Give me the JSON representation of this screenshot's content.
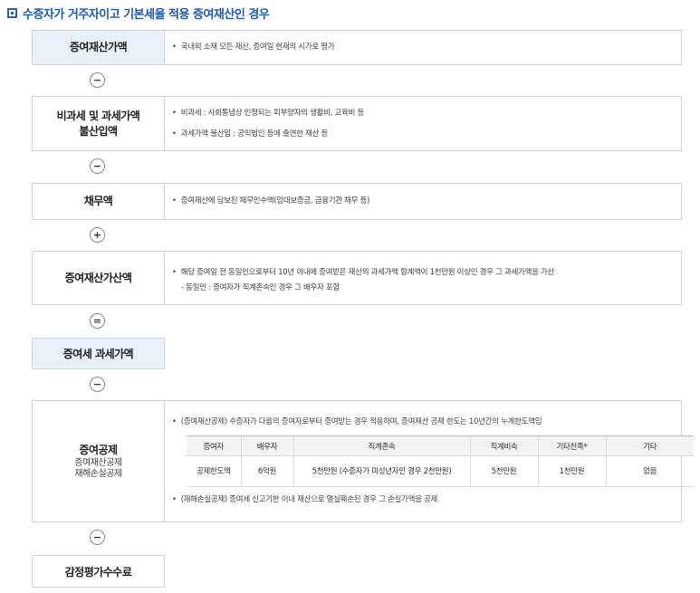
{
  "title": "수증자가 거주자이고 기본세율 적용 증여재산인 경우",
  "operators": {
    "minus": "−",
    "plus": "+",
    "equals": "="
  },
  "rows": {
    "r1": {
      "label": "증여재산가액",
      "bullets": [
        "국내외 소재 모든 재산, 증여일 현재의 시가로 평가"
      ]
    },
    "r2": {
      "label_line1": "비과세 및 과세가액",
      "label_line2": "불산입액",
      "bullets": [
        "비과세 : 사회통념상 인정되는 피부양자의 생활비, 교육비 등",
        "과세가액 불산입 : 공익법인 등에 출연한 재산 등"
      ]
    },
    "r3": {
      "label": "채무액",
      "bullets": [
        "증여재산에 담보된 채무인수액(임대보증금, 금융기관 채무 등)"
      ]
    },
    "r4": {
      "label": "증여재산가산액",
      "bullets": [
        "해당 증여일 전 동일인으로부터 10년 이내에 증여받은 재산의 과세가액 합계액이 1천만원 이상인 경우 그 과세가액을 가산"
      ],
      "dash": "- 동일인 : 증여자가 직계존속인 경우 그 배우자 포함"
    },
    "r5": {
      "label": "증여세 과세가액"
    },
    "r6": {
      "label": "증여공제",
      "sub1": "증여재산공제",
      "sub2": "재해손실공제",
      "bullet1": "(증여재산공제) 수증자가 다음의 증여자로부터 증여받는 경우 적용하며, 증여재산 공제 한도는 10년간의 누계한도액임",
      "bullet2": "(재해손실공제) 증여세 신고기한 이내 재산으로 멸실훼손된 경우 그 손실가액을 공제"
    },
    "r7": {
      "label": "감정평가수수료"
    }
  },
  "deduction_table": {
    "headers": [
      "증여자",
      "배우자",
      "직계존속",
      "직계비속",
      "기타친족*",
      "기타"
    ],
    "row": [
      "공제한도액",
      "6억원",
      "5천만원 (수증자가 미성년자인 경우 2천만원)",
      "5천만원",
      "1천만원",
      "없음"
    ]
  }
}
